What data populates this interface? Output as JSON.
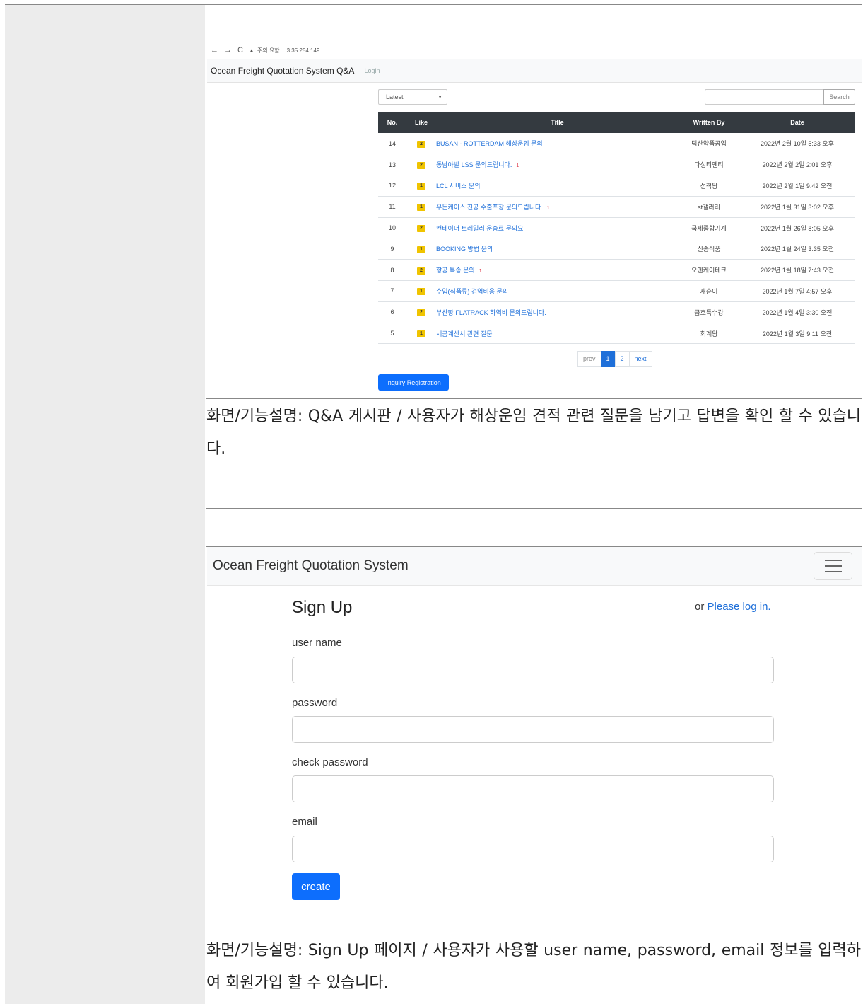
{
  "qa_screen": {
    "browser": {
      "back": "←",
      "forward": "→",
      "reload": "C",
      "warning": "▲",
      "security_text": "주의 요함",
      "separator": "|",
      "url": "3.35.254.149"
    },
    "navbar": {
      "brand": "Ocean Freight Quotation System Q&A",
      "login": "Login"
    },
    "sort_select": {
      "value": "Latest"
    },
    "search": {
      "button": "Search"
    },
    "table": {
      "headers": [
        "No.",
        "Like",
        "Title",
        "Written By",
        "Date"
      ],
      "rows": [
        {
          "no": "14",
          "like": "2",
          "title": "BUSAN - ROTTERDAM 해상운임 문의",
          "comments": "",
          "writer": "덕산약품공업",
          "date": "2022년 2월 10일 5:33 오후"
        },
        {
          "no": "13",
          "like": "2",
          "title": "동남아발 LSS 문의드립니다.",
          "comments": "1",
          "writer": "다성티엔티",
          "date": "2022년 2월 2일 2:01 오후"
        },
        {
          "no": "12",
          "like": "1",
          "title": "LCL 서비스 문의",
          "comments": "",
          "writer": "선적왕",
          "date": "2022년 2월 1일 9:42 오전"
        },
        {
          "no": "11",
          "like": "1",
          "title": "우든케이스 진공 수출포장 문의드립니다.",
          "comments": "1",
          "writer": "st갤러리",
          "date": "2022년 1월 31일 3:02 오후"
        },
        {
          "no": "10",
          "like": "2",
          "title": "컨테이너 트레일러 운송료 문의요",
          "comments": "",
          "writer": "국제종합기계",
          "date": "2022년 1월 26일 8:05 오후"
        },
        {
          "no": "9",
          "like": "1",
          "title": "BOOKING 방법 문의",
          "comments": "",
          "writer": "신송식품",
          "date": "2022년 1월 24일 3:35 오전"
        },
        {
          "no": "8",
          "like": "2",
          "title": "항공 특송 문의",
          "comments": "1",
          "writer": "오엔케이테크",
          "date": "2022년 1월 18일 7:43 오전"
        },
        {
          "no": "7",
          "like": "1",
          "title": "수입(식품류) 검역비용 문의",
          "comments": "",
          "writer": "재순이",
          "date": "2022년 1월 7일 4:57 오후"
        },
        {
          "no": "6",
          "like": "2",
          "title": "부산항 FLATRACK 하역비 문의드립니다.",
          "comments": "",
          "writer": "금호특수강",
          "date": "2022년 1월 4일 3:30 오전"
        },
        {
          "no": "5",
          "like": "1",
          "title": "세금계산서 관련 질문",
          "comments": "",
          "writer": "회계왕",
          "date": "2022년 1월 3일 9:11 오전"
        }
      ]
    },
    "pagination": {
      "prev": "prev",
      "pages": [
        "1",
        "2"
      ],
      "next": "next"
    },
    "inquiry_button": "Inquiry Registration"
  },
  "descriptions": {
    "qa": "화면/기능설명: Q&A 게시판 / 사용자가 해상운임 견적 관련 질문을 남기고 답변을 확인 할 수 있습니다.",
    "signup": "화면/기능설명: Sign Up 페이지 / 사용자가 사용할 user name, password, email 정보를 입력하여 회원가입 할 수 있습니다."
  },
  "signup_screen": {
    "navbar": {
      "brand": "Ocean Freight Quotation System"
    },
    "title": "Sign Up",
    "or_text": "or",
    "login_link": "Please log in.",
    "fields": [
      {
        "label": "user name",
        "value": ""
      },
      {
        "label": "password",
        "value": ""
      },
      {
        "label": "check password",
        "value": ""
      },
      {
        "label": "email",
        "value": ""
      }
    ],
    "create_button": "create"
  }
}
